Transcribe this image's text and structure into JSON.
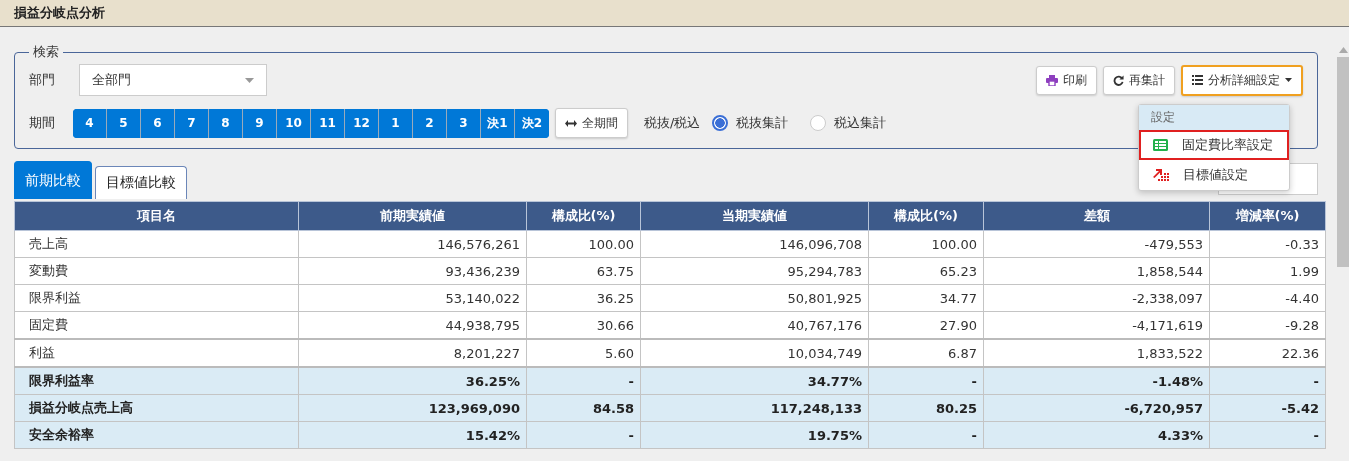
{
  "page_title": "損益分岐点分析",
  "search": {
    "legend": "検索",
    "department": {
      "label": "部門",
      "value": "全部門"
    },
    "period": {
      "label": "期間",
      "months": [
        {
          "label": "4",
          "selected": true
        },
        {
          "label": "5",
          "selected": true
        },
        {
          "label": "6",
          "selected": true
        },
        {
          "label": "7",
          "selected": true
        },
        {
          "label": "8",
          "selected": true
        },
        {
          "label": "9",
          "selected": true
        },
        {
          "label": "10",
          "selected": true
        },
        {
          "label": "11",
          "selected": true
        },
        {
          "label": "12",
          "selected": true
        },
        {
          "label": "1",
          "selected": true
        },
        {
          "label": "2",
          "selected": true
        },
        {
          "label": "3",
          "selected": true
        },
        {
          "label": "決1",
          "selected": true
        },
        {
          "label": "決2",
          "selected": true
        }
      ],
      "all_button": "全期間"
    },
    "tax": {
      "label": "税抜/税込",
      "options": [
        {
          "label": "税抜集計",
          "selected": true
        },
        {
          "label": "税込集計",
          "selected": false
        }
      ]
    },
    "buttons": [
      {
        "label": "印刷",
        "kind": "print"
      },
      {
        "label": "再集計",
        "kind": "refresh"
      },
      {
        "label": "分析詳細設定",
        "kind": "menu"
      }
    ]
  },
  "menu": {
    "header": "設定",
    "items": [
      {
        "label": "固定費比率設定",
        "kind": "table",
        "selected": true
      },
      {
        "label": "目標値設定",
        "kind": "target",
        "selected": false
      }
    ]
  },
  "tabs": [
    {
      "label": "前期比較",
      "selected": true
    },
    {
      "label": "目標値比較",
      "selected": false
    }
  ],
  "table": {
    "columns": [
      "項目名",
      "前期実績値",
      "構成比(%)",
      "当期実績値",
      "構成比(%)",
      "差額",
      "増減率(%)"
    ],
    "rows": [
      {
        "kind": "normal",
        "cells": [
          "売上高",
          "146,576,261",
          "100.00",
          "146,096,708",
          "100.00",
          "-479,553",
          "-0.33"
        ]
      },
      {
        "kind": "normal",
        "cells": [
          "変動費",
          "93,436,239",
          "63.75",
          "95,294,783",
          "65.23",
          "1,858,544",
          "1.99"
        ]
      },
      {
        "kind": "normal",
        "cells": [
          "限界利益",
          "53,140,022",
          "36.25",
          "50,801,925",
          "34.77",
          "-2,338,097",
          "-4.40"
        ]
      },
      {
        "kind": "normal",
        "cells": [
          "固定費",
          "44,938,795",
          "30.66",
          "40,767,176",
          "27.90",
          "-4,171,619",
          "-9.28"
        ]
      },
      {
        "kind": "total",
        "cells": [
          "利益",
          "8,201,227",
          "5.60",
          "10,034,749",
          "6.87",
          "1,833,522",
          "22.36"
        ]
      },
      {
        "kind": "summary",
        "cells": [
          "限界利益率",
          "36.25%",
          "-",
          "34.77%",
          "-",
          "-1.48%",
          "-"
        ]
      },
      {
        "kind": "summary",
        "cells": [
          "損益分岐点売上高",
          "123,969,090",
          "84.58",
          "117,248,133",
          "80.25",
          "-6,720,957",
          "-5.42"
        ]
      },
      {
        "kind": "summary",
        "cells": [
          "安全余裕率",
          "15.42%",
          "-",
          "19.75%",
          "-",
          "4.33%",
          "-"
        ]
      }
    ]
  }
}
